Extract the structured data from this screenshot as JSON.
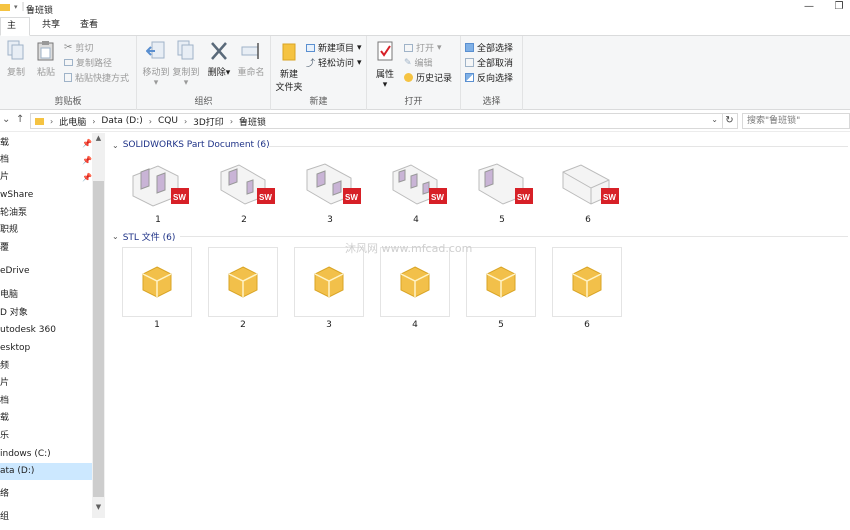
{
  "window": {
    "title": "鲁班锁",
    "restore_glyph": "❐",
    "minimize_glyph": "—"
  },
  "ribbon_tabs": [
    {
      "label": "主页",
      "active": true
    },
    {
      "label": "共享",
      "active": false
    },
    {
      "label": "查看",
      "active": false
    }
  ],
  "ribbon": {
    "clipboard": {
      "label": "剪贴板",
      "copy": "复制",
      "paste": "粘贴",
      "cut": "剪切",
      "copy_path": "复制路径",
      "paste_shortcut": "粘贴快捷方式"
    },
    "organize": {
      "label": "组织",
      "move_to": "移动到",
      "copy_to": "复制到",
      "delete": "删除",
      "rename": "重命名"
    },
    "new": {
      "label": "新建",
      "new_folder_line1": "新建",
      "new_folder_line2": "文件夹",
      "new_item": "新建项目",
      "easy_access": "轻松访问"
    },
    "open": {
      "label": "打开",
      "properties": "属性",
      "open": "打开",
      "edit": "编辑",
      "history": "历史记录"
    },
    "select": {
      "label": "选择",
      "select_all": "全部选择",
      "select_none": "全部取消",
      "invert": "反向选择"
    }
  },
  "address": {
    "segments": [
      "此电脑",
      "Data (D:)",
      "CQU",
      "3D打印",
      "鲁班锁"
    ],
    "search_placeholder": "搜索\"鲁班锁\""
  },
  "nav_pane": [
    {
      "label": "载",
      "pinned": true
    },
    {
      "label": "档",
      "pinned": true
    },
    {
      "label": "片",
      "pinned": true
    },
    {
      "label": "wShare",
      "pinned": false
    },
    {
      "label": "轮油泵",
      "pinned": false
    },
    {
      "label": "职规",
      "pinned": false
    },
    {
      "label": "覆",
      "pinned": false
    },
    {
      "label": "eDrive",
      "pinned": false
    },
    {
      "label": "电脑",
      "pinned": false
    },
    {
      "label": "D 对象",
      "pinned": false
    },
    {
      "label": "utodesk 360",
      "pinned": false
    },
    {
      "label": "esktop",
      "pinned": false
    },
    {
      "label": "频",
      "pinned": false
    },
    {
      "label": "片",
      "pinned": false
    },
    {
      "label": "档",
      "pinned": false
    },
    {
      "label": "载",
      "pinned": false
    },
    {
      "label": "乐",
      "pinned": false
    },
    {
      "label": "indows (C:)",
      "pinned": false
    },
    {
      "label": "ata (D:)",
      "pinned": false,
      "selected": true
    },
    {
      "label": "络",
      "pinned": false
    },
    {
      "label": "组",
      "pinned": false
    }
  ],
  "groups": [
    {
      "header": "SOLIDWORKS Part Document (6)",
      "items": [
        "1",
        "2",
        "3",
        "4",
        "5",
        "6"
      ]
    },
    {
      "header": "STL 文件 (6)",
      "items": [
        "1",
        "2",
        "3",
        "4",
        "5",
        "6"
      ]
    }
  ],
  "sw_badge": "SW",
  "watermark": "沐风网 www.mfcad.com",
  "colors": {
    "accent": "#1979ca",
    "selected_bg": "#cce8ff",
    "group_header": "#1e3287",
    "sw_red": "#d72027",
    "stl_gold": "#f2c04a"
  }
}
